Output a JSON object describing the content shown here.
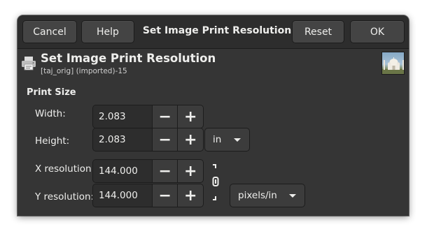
{
  "header": {
    "cancel_label": "Cancel",
    "help_label": "Help",
    "title": "Set Image Print Resolution",
    "reset_label": "Reset",
    "ok_label": "OK"
  },
  "content": {
    "title": "Set Image Print Resolution",
    "subtitle": "[taj_orig] (imported)-15",
    "section_title": "Print Size"
  },
  "fields": {
    "width": {
      "label": "Width:",
      "value": "2.083"
    },
    "height": {
      "label": "Height:",
      "value": "2.083"
    },
    "size_unit": "in",
    "x_resolution": {
      "label": "X resolution:",
      "value": "144.000"
    },
    "y_resolution": {
      "label": "Y resolution:",
      "value": "144.000"
    },
    "resolution_unit": "pixels/in"
  },
  "icons": {
    "printer": "printer-icon",
    "minus": "minus-icon",
    "plus": "plus-icon",
    "chain": "chain-link-icon",
    "dropdown": "chevron-down-icon",
    "thumbnail": "image-thumbnail"
  },
  "colors": {
    "background": "#353535",
    "headerbar": "#2d2d2d",
    "button": "#444444",
    "text": "#eeeeec"
  }
}
